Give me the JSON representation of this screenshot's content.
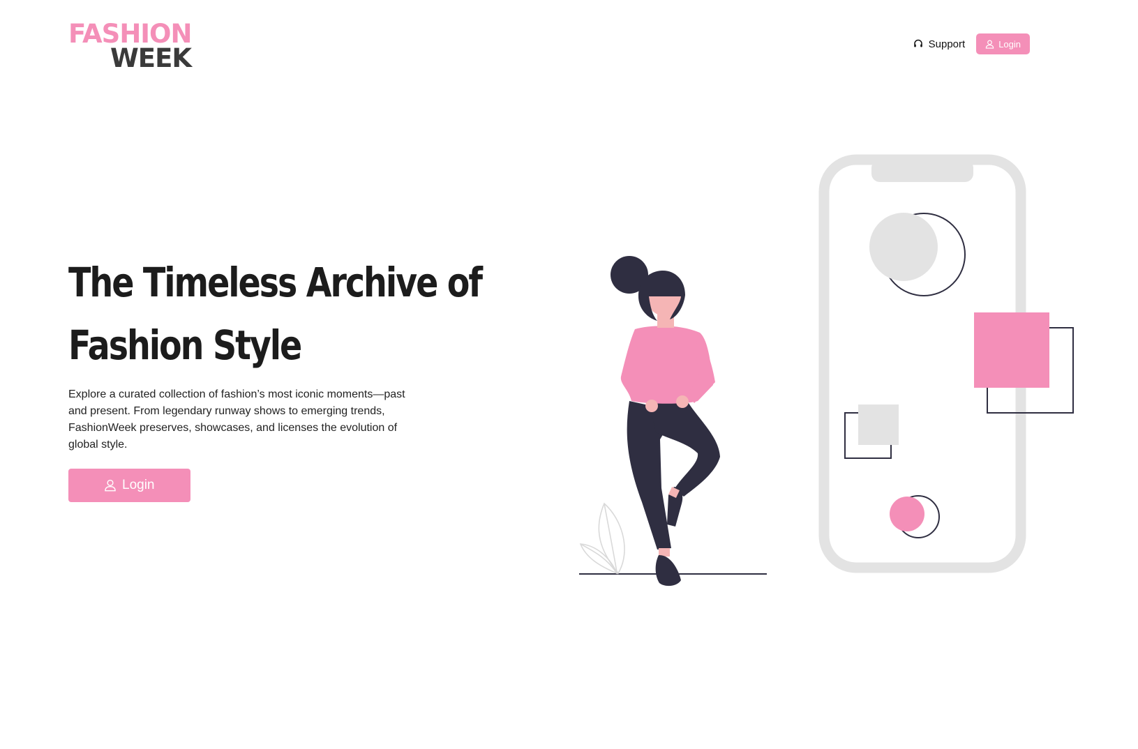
{
  "brand": {
    "line1": "FASHION",
    "line2": "WEEK"
  },
  "nav": {
    "support_label": "Support",
    "login_label": "Login",
    "support_icon": "headset-icon",
    "login_icon": "user-icon"
  },
  "hero": {
    "title": "The Timeless Archive of Fashion Style",
    "description": "Explore a curated collection of fashion’s most iconic moments—past and present. From legendary runway shows to emerging trends, FashionWeek preserves, showcases, and licenses the evolution of global style.",
    "login_label": "Login",
    "login_icon": "user-icon"
  },
  "colors": {
    "accent": "#f48fb8",
    "dark": "#2f2e41",
    "light_gray": "#e3e3e3",
    "skin": "#f5b5b5"
  }
}
